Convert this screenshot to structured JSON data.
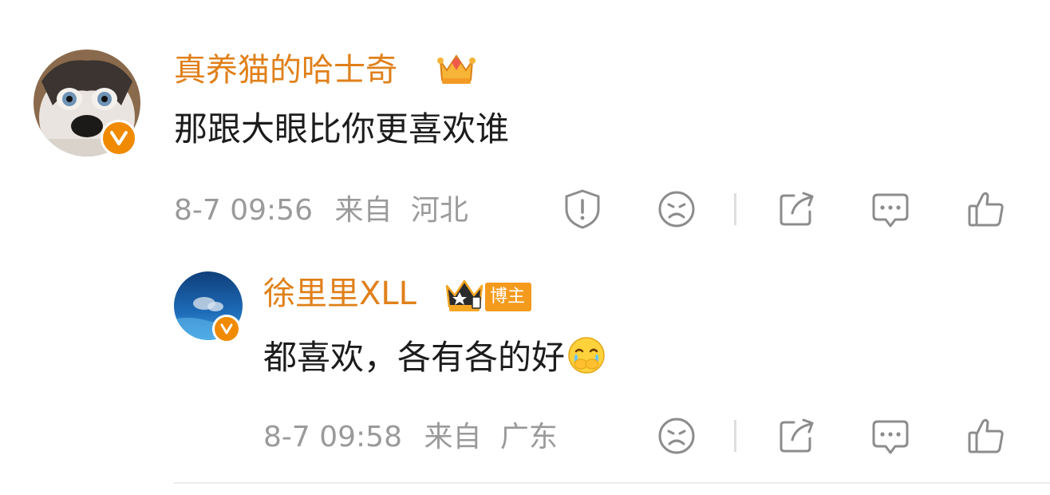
{
  "comment": {
    "username": "真养猫的哈士奇",
    "text": "那跟大眼比你更喜欢谁",
    "date": "8-7 09:56",
    "from_label": "来自",
    "location": "河北"
  },
  "reply": {
    "username": "徐里里XLL",
    "badge_label": "博主",
    "text": "都喜欢，各有各的好",
    "date": "8-7 09:58",
    "from_label": "来自",
    "location": "广东"
  },
  "colors": {
    "username": "#e0801a",
    "meta": "#9a9a9a",
    "badge": "#f49a1c",
    "icon_stroke": "#8c8c8c"
  },
  "icons": {
    "comment_actions": [
      "report-icon",
      "dislike-icon",
      "share-icon",
      "comment-icon",
      "like-icon"
    ],
    "reply_actions": [
      "dislike-icon",
      "share-icon",
      "comment-icon",
      "like-icon"
    ],
    "emoji": "crying-emoji"
  }
}
